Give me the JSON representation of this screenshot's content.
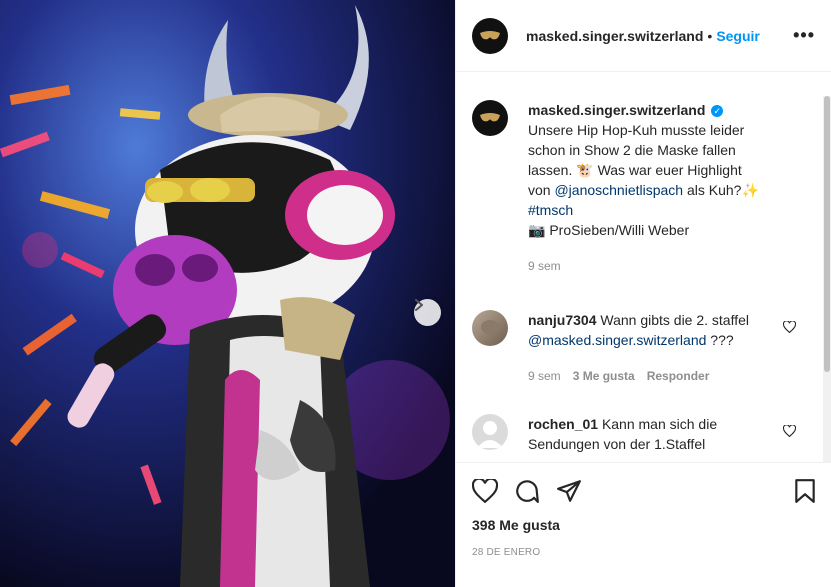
{
  "header": {
    "username": "masked.singer.switzerland",
    "separator": "•",
    "follow_label": "Seguir",
    "more_label": "•••"
  },
  "caption": {
    "username": "masked.singer.switzerland",
    "verified_mark": "✓",
    "text_1": "Unsere Hip Hop-Kuh musste leider schon in Show 2 die Maske fallen lassen. 🐮 Was war euer Highlight von",
    "mention": "@janoschnietlispach",
    "text_2": "als Kuh?✨",
    "hashtag": "#tmsch",
    "credit": "📷 ProSieben/Willi Weber",
    "time": "9 sem"
  },
  "comments": [
    {
      "username": "nanju7304",
      "text": "Wann gibts die 2. staffel",
      "mention": "@masked.singer.switzerland",
      "text_after": "???",
      "time": "9 sem",
      "likes": "3 Me gusta",
      "reply_label": "Responder"
    },
    {
      "username": "rochen_01",
      "text": "Kann man sich die Sendungen von der 1.Staffel"
    }
  ],
  "footer": {
    "likes": "398 Me gusta",
    "date": "28 DE ENERO"
  },
  "icons": {
    "like": "heart-icon",
    "comment": "comment-icon",
    "share": "share-icon",
    "save": "bookmark-icon",
    "next": "chevron-right-icon"
  },
  "colors": {
    "accent": "#0095f6",
    "link": "#00376b",
    "muted": "#8e8e8e"
  }
}
